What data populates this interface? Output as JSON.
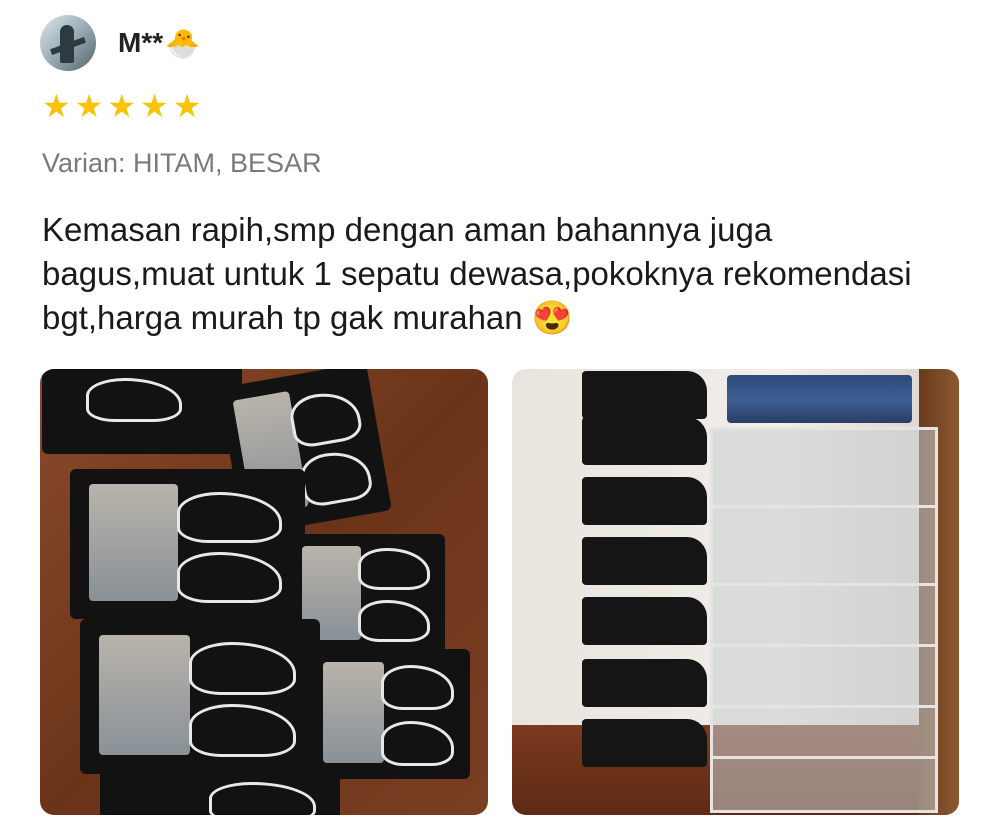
{
  "review": {
    "username": "M**",
    "user_emoji": "🐣",
    "rating": 5,
    "variant": "Varian: HITAM, BESAR",
    "text": "Kemasan rapih,smp dengan aman bahannya juga bagus,muat untuk 1 sepatu dewasa,pokoknya rekomendasi bgt,harga murah tp gak murahan 😍"
  },
  "colors": {
    "star": "#f7c40a",
    "variant_text": "#7a7a7a",
    "body_text": "#1a1a1a"
  },
  "icons": {
    "star": "star-icon"
  }
}
